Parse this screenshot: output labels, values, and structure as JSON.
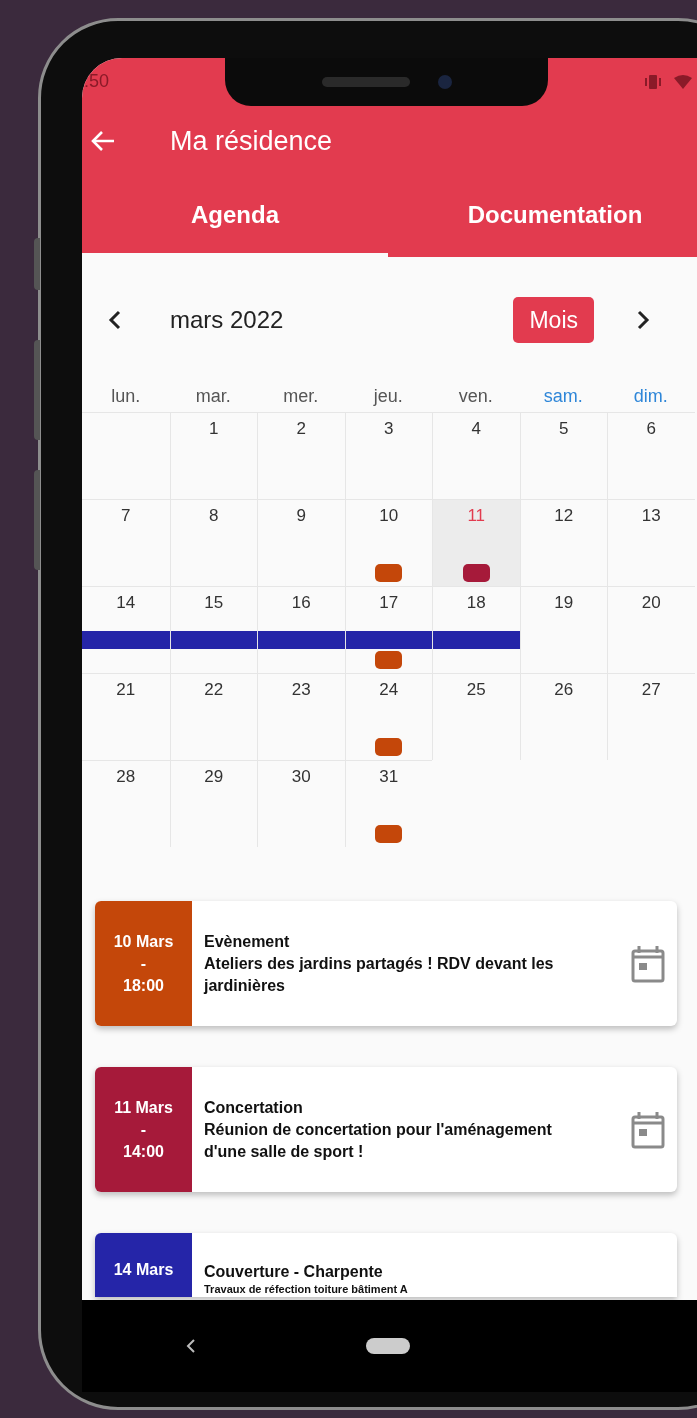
{
  "status_bar": {
    "time": ":50"
  },
  "app_bar": {
    "title": "Ma résidence"
  },
  "tabs": [
    {
      "label": "Agenda",
      "selected": true
    },
    {
      "label": "Documentation",
      "selected": false
    }
  ],
  "calendar": {
    "month": "mars 2022",
    "view_button": "Mois",
    "weekdays": [
      {
        "label": "lun.",
        "weekend": false
      },
      {
        "label": "mar.",
        "weekend": false
      },
      {
        "label": "mer.",
        "weekend": false
      },
      {
        "label": "jeu.",
        "weekend": false
      },
      {
        "label": "ven.",
        "weekend": false
      },
      {
        "label": "sam.",
        "weekend": true
      },
      {
        "label": "dim.",
        "weekend": true
      }
    ],
    "weeks": [
      [
        {
          "selected": false
        },
        {
          "day": "1",
          "selected": false
        },
        {
          "day": "2",
          "selected": false
        },
        {
          "day": "3",
          "selected": false
        },
        {
          "day": "4",
          "selected": false
        },
        {
          "day": "5",
          "selected": false
        },
        {
          "day": "6",
          "selected": false
        }
      ],
      [
        {
          "day": "7",
          "selected": false
        },
        {
          "day": "8",
          "selected": false
        },
        {
          "day": "9",
          "selected": false
        },
        {
          "day": "10",
          "selected": false,
          "events": [
            {
              "kind": "dot",
              "color": "#c4470a"
            }
          ]
        },
        {
          "day": "11",
          "selected": true,
          "events": [
            {
              "kind": "dot",
              "color": "#a61a3a"
            }
          ]
        },
        {
          "day": "12",
          "selected": false
        },
        {
          "day": "13",
          "selected": false
        }
      ],
      [
        {
          "day": "14",
          "selected": false,
          "events": [
            {
              "kind": "bar",
              "color": "#2525a8"
            }
          ]
        },
        {
          "day": "15",
          "selected": false,
          "events": [
            {
              "kind": "bar",
              "color": "#2525a8"
            }
          ]
        },
        {
          "day": "16",
          "selected": false,
          "events": [
            {
              "kind": "bar",
              "color": "#2525a8"
            }
          ]
        },
        {
          "day": "17",
          "selected": false,
          "events": [
            {
              "kind": "bar",
              "color": "#2525a8"
            },
            {
              "kind": "dot",
              "color": "#c4470a"
            }
          ]
        },
        {
          "day": "18",
          "selected": false,
          "events": [
            {
              "kind": "bar",
              "color": "#2525a8"
            }
          ]
        },
        {
          "day": "19",
          "selected": false
        },
        {
          "day": "20",
          "selected": false
        }
      ],
      [
        {
          "day": "21",
          "selected": false
        },
        {
          "day": "22",
          "selected": false
        },
        {
          "day": "23",
          "selected": false
        },
        {
          "day": "24",
          "selected": false,
          "events": [
            {
              "kind": "dot",
              "color": "#c4470a"
            }
          ]
        },
        {
          "day": "25",
          "selected": false
        },
        {
          "day": "26",
          "selected": false
        },
        {
          "day": "27",
          "selected": false
        }
      ],
      [
        {
          "day": "28",
          "selected": false
        },
        {
          "day": "29",
          "selected": false
        },
        {
          "day": "30",
          "selected": false
        },
        {
          "day": "31",
          "selected": false,
          "events": [
            {
              "kind": "dot",
              "color": "#c4470a"
            }
          ]
        }
      ]
    ]
  },
  "events": [
    {
      "date": "10 Mars",
      "separator": "-",
      "time": "18:00",
      "color": "#c4470a",
      "title": "Evènement",
      "description": "Ateliers des jardins partagés ! RDV devant les jardinières"
    },
    {
      "date": "11 Mars",
      "separator": "-",
      "time": "14:00",
      "color": "#a61a3a",
      "title": "Concertation",
      "description": "Réunion de concertation pour l'aménagement d'une salle de sport !"
    },
    {
      "date": "14 Mars",
      "color": "#2525a8",
      "title": "Couverture - Charpente",
      "description": "Travaux de réfection toiture bâtiment A"
    }
  ]
}
